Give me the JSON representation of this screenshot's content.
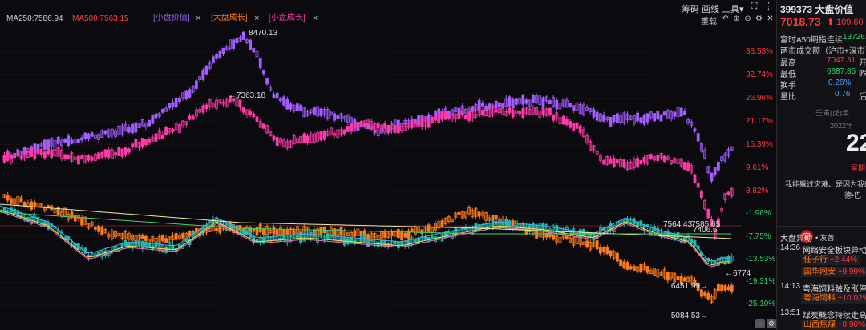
{
  "header": {
    "ma250": "MA250:7586.94",
    "ma500": "MA500:7563.15",
    "legends": [
      {
        "label": "[小盘价值]",
        "color": "#a35cff"
      },
      {
        "label": "[大盘成长]",
        "color": "#ff7a1a"
      },
      {
        "label": "[小盘成长]",
        "color": "#ff3aa8"
      }
    ],
    "close_glyph": "×",
    "toolbar": {
      "chips": "筹码",
      "draw": "画线",
      "tools": "工具",
      "dropdown": "▾"
    },
    "reset_label": "重载"
  },
  "chart": {
    "percent_labels": [
      {
        "text": "38.53%",
        "color": "#ff3b3b"
      },
      {
        "text": "32.74%",
        "color": "#ff3b3b"
      },
      {
        "text": "26.96%",
        "color": "#ff3b3b"
      },
      {
        "text": "21.17%",
        "color": "#ff3b3b"
      },
      {
        "text": "15.39%",
        "color": "#ff3b3b"
      },
      {
        "text": "9.61%",
        "color": "#ff3b3b"
      },
      {
        "text": "3.82%",
        "color": "#ff3b3b"
      },
      {
        "text": "-1.96%",
        "color": "#2fd06b"
      },
      {
        "text": "-7.75%",
        "color": "#2fd06b"
      },
      {
        "text": "-13.53%",
        "color": "#2fd06b"
      },
      {
        "text": "-19.31%",
        "color": "#2fd06b"
      },
      {
        "text": "-25.10%",
        "color": "#2fd06b"
      }
    ],
    "annotations": {
      "high_purple": "8470.13",
      "high_pink": "7363.18",
      "mid_a": "7564.43",
      "mid_b": "7585.65",
      "mid_c": "7406.6",
      "low_a": "6451.99",
      "low_b": "5084.53",
      "right_tag": "6774"
    }
  },
  "side": {
    "title": "399373 大盘价值",
    "price": "7018.73",
    "change": "109.60",
    "arrow": "⬆",
    "a50_label": "富时A50期指连续:",
    "a50_value": "13726.0",
    "turnover_label": "两市成交额（沪市+深市）",
    "rows": [
      {
        "label": "最高",
        "value": "7047.31",
        "suffix": "开",
        "color": "#ff3b3b"
      },
      {
        "label": "最低",
        "value": "6887.85",
        "suffix": "昨",
        "color": "#2fd06b"
      },
      {
        "label": "换手",
        "value": "0.26%",
        "suffix": "",
        "color": "#4aa8ff"
      },
      {
        "label": "量比",
        "value": "0.76",
        "suffix": "后",
        "color": "#4aa8ff"
      }
    ],
    "lunar": "壬寅(虎)年",
    "year": "2022年",
    "day": "22",
    "weekday": "星期",
    "quote_line1": "我能躲过灾难、是因为我的",
    "quote_line2": "德•巴",
    "yi_label": "宜",
    "yi_text": "• 友善",
    "market_news_title": "大盘异动",
    "news": [
      {
        "time": "14:36",
        "title": "网络安全板块异动拉",
        "stocks": [
          {
            "name": "任子行",
            "change": "+2.44%"
          },
          {
            "name": "国华网安",
            "change": "+9.99%"
          }
        ]
      },
      {
        "time": "14:13",
        "title": "粤海饲料触及涨停",
        "stocks": [
          {
            "name": "粤海饲料",
            "change": "+10.02%"
          }
        ]
      },
      {
        "time": "13:51",
        "title": "煤炭概念持续走高",
        "stocks": [
          {
            "name": "山西焦煤",
            "change": "+8.90%"
          }
        ]
      }
    ]
  }
}
